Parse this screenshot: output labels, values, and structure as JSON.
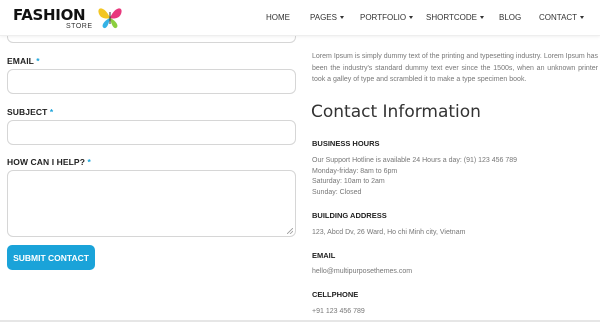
{
  "logo": {
    "main": "FASHION",
    "sub": "STORE"
  },
  "nav": [
    {
      "label": "HOME",
      "has_caret": false
    },
    {
      "label": "PAGES",
      "has_caret": true
    },
    {
      "label": "PORTFOLIO",
      "has_caret": true
    },
    {
      "label": "SHORTCODE",
      "has_caret": true
    },
    {
      "label": "BLOG",
      "has_caret": false
    },
    {
      "label": "CONTACT",
      "has_caret": true
    }
  ],
  "form": {
    "email_label": "EMAIL",
    "subject_label": "SUBJECT",
    "help_label": "HOW CAN I HELP?",
    "required_mark": "*",
    "email_value": "",
    "subject_value": "",
    "help_value": "",
    "submit_label": "SUBMIT CONTACT"
  },
  "info": {
    "intro": "Lorem Ipsum is simply dummy text of the printing and typesetting industry. Lorem Ipsum has been the industry's standard dummy text ever since the 1500s, when an unknown printer took a galley of type and scrambled it to make a type specimen book.",
    "title": "Contact Information",
    "hours_heading": "BUSINESS HOURS",
    "hours_lines": [
      "Our Support Hotline is available 24 Hours a day: (91) 123 456 789",
      "Monday-friday: 8am to 6pm",
      "Saturday: 10am to 2am",
      "Sunday: Closed"
    ],
    "address_heading": "BUILDING ADDRESS",
    "address": "123, Abcd Dv, 26 Ward, Ho chi Minh city, Vietnam",
    "email_heading": "EMAIL",
    "email": "hello@multipurposethemes.com",
    "cellphone_heading": "CELLPHONE",
    "cellphone": "+91 123 456 789"
  },
  "colors": {
    "accent": "#1aa3d9"
  }
}
